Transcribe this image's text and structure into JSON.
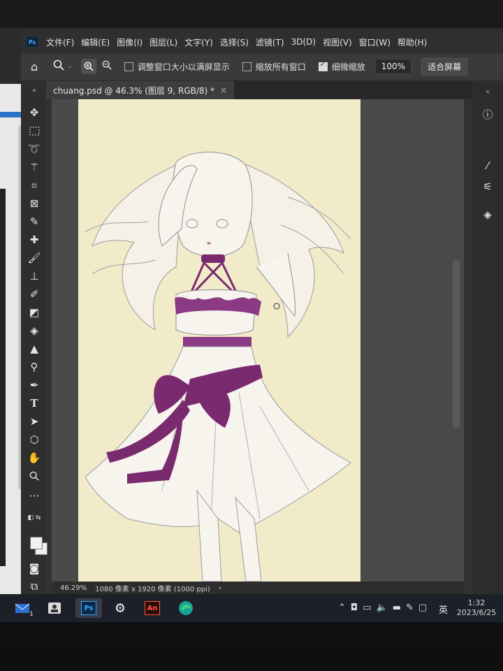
{
  "app": {
    "name": "Photoshop",
    "logo_text": "Ps"
  },
  "menubar": {
    "items": [
      {
        "label": "文件(F)"
      },
      {
        "label": "编辑(E)"
      },
      {
        "label": "图像(I)"
      },
      {
        "label": "图层(L)"
      },
      {
        "label": "文字(Y)"
      },
      {
        "label": "选择(S)"
      },
      {
        "label": "滤镜(T)"
      },
      {
        "label": "3D(D)"
      },
      {
        "label": "视图(V)"
      },
      {
        "label": "窗口(W)"
      },
      {
        "label": "帮助(H)"
      }
    ]
  },
  "options": {
    "fit_window_label": "调整窗口大小以满屏显示",
    "fit_window_checked": false,
    "zoom_all_label": "缩放所有窗口",
    "zoom_all_checked": false,
    "scrubby_label": "细微缩放",
    "scrubby_checked": true,
    "zoom_value": "100%",
    "fit_screen_label": "适合屏幕"
  },
  "document": {
    "tab_title": "chuang.psd @ 46.3% (图层 9, RGB/8) *",
    "close_glyph": "×",
    "canvas_color": "#f2ebc9",
    "accent_purple": "#7a2a6e"
  },
  "status": {
    "zoom": "46.29%",
    "info": "1080 像素 x 1920 像素 (1000 ppi)",
    "arrow": "›"
  },
  "taskbar": {
    "ps_label": "Ps",
    "an_label": "An",
    "mail_badge": "1",
    "tray_ime": "英",
    "time": "1:32",
    "date": "2023/6/25"
  }
}
